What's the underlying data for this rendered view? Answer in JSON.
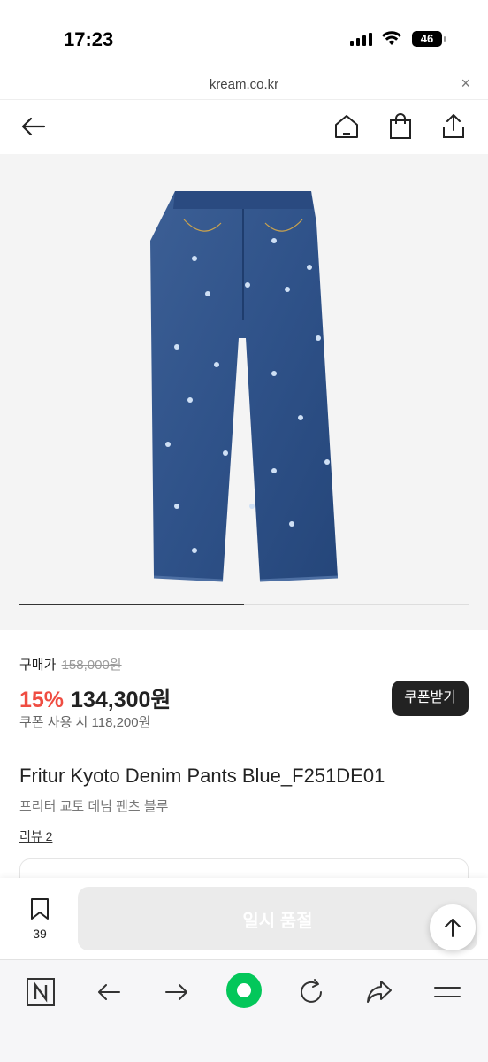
{
  "status_bar": {
    "time": "17:23",
    "battery": "46"
  },
  "browser": {
    "url": "kream.co.kr",
    "close_icon": "×"
  },
  "header": {
    "icons": [
      "back-arrow-icon",
      "home-icon",
      "shopping-bag-icon",
      "share-icon"
    ]
  },
  "product_image": {
    "alt": "Fritur Kyoto Denim Pants Blue",
    "carousel_progress": 0.5
  },
  "pricing": {
    "buy_label": "구매가",
    "original_price": "158,000원",
    "discount": "15%",
    "price": "134,300원",
    "coupon_button": "쿠폰받기",
    "coupon_note": "쿠폰 사용 시 118,200원"
  },
  "product": {
    "title": "Fritur Kyoto Denim Pants Blue_F251DE01",
    "subtitle": "프리터 교토 데님 팬츠 블루",
    "review_link": "리뷰 2"
  },
  "action_bar": {
    "bookmark_count": "39",
    "soldout_label": "일시 품절"
  },
  "colors": {
    "accent": "#ef4d42",
    "dark_button": "#222222",
    "naver_green": "#03c75a"
  }
}
